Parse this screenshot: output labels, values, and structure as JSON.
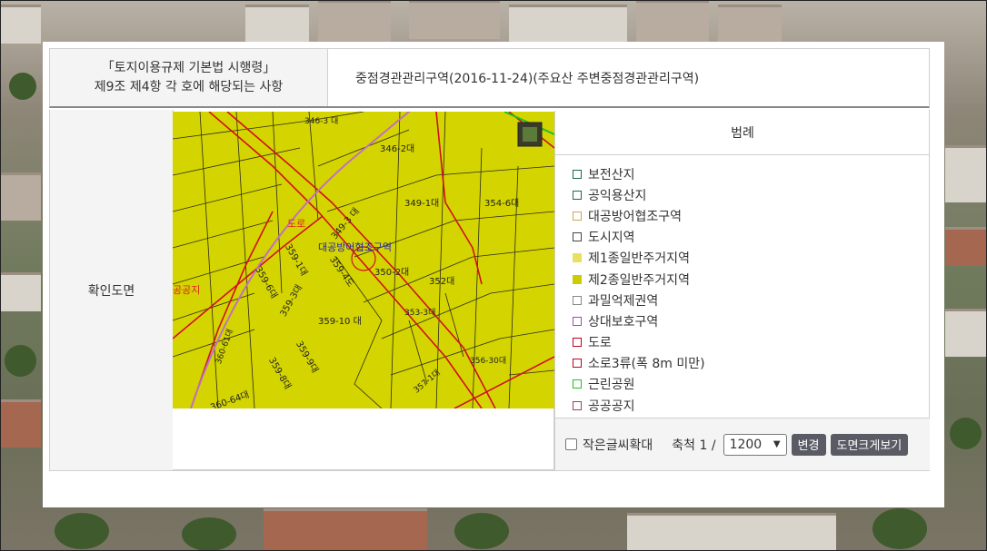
{
  "row1": {
    "label_line1": "「토지이용규제 기본법 시행령」",
    "label_line2": "제9조 제4항 각 호에 해당되는 사항",
    "value": "중점경관관리구역(2016-11-24)(주요산 주변중점경관관리구역)"
  },
  "row2": {
    "label": "확인도면"
  },
  "map": {
    "parcels": [
      "346-3 대",
      "346-2대",
      "349-1대",
      "354-6대",
      "349-3 대",
      "359-1대",
      "359-6대",
      "359-3대",
      "359-4도",
      "350-2대",
      "352대",
      "353-3대",
      "359-10 대",
      "359-8대",
      "359-9대",
      "356-30대",
      "357-1대",
      "360-64대",
      "360-61대"
    ],
    "labels": {
      "road": "도로",
      "zone": "대공방어협조구역",
      "public": "공공지"
    }
  },
  "legend": {
    "title": "범례",
    "items": [
      {
        "label": "보전산지",
        "color": "#1e6a4a",
        "fill": "#ffffff"
      },
      {
        "label": "공익용산지",
        "color": "#1e6a4a",
        "fill": "#ffffff"
      },
      {
        "label": "대공방어협조구역",
        "color": "#c8a858",
        "fill": "#ffffff"
      },
      {
        "label": "도시지역",
        "color": "#444444",
        "fill": "#ffffff"
      },
      {
        "label": "제1종일반주거지역",
        "color": "#e8e060",
        "fill": "#e8e060"
      },
      {
        "label": "제2종일반주거지역",
        "color": "#cccc00",
        "fill": "#cccc00"
      },
      {
        "label": "과밀억제권역",
        "color": "#888888",
        "fill": "#ffffff"
      },
      {
        "label": "상대보호구역",
        "color": "#b040c0",
        "fill": "#ffffff"
      },
      {
        "label": "도로",
        "color": "#c00020",
        "fill": "#ffffff"
      },
      {
        "label": "소로3류(폭 8m 미만)",
        "color": "#c00020",
        "fill": "#ffffff"
      },
      {
        "label": "근린공원",
        "color": "#20c020",
        "fill": "#ffffff"
      },
      {
        "label": "공공공지",
        "color": "#a04050",
        "fill": "#ffffff"
      }
    ],
    "zoom_checkbox_label": "작은글씨확대",
    "scale_label": "축척 1 /",
    "scale_value": "1200",
    "change_button": "변경",
    "enlarge_button": "도면크게보기"
  }
}
